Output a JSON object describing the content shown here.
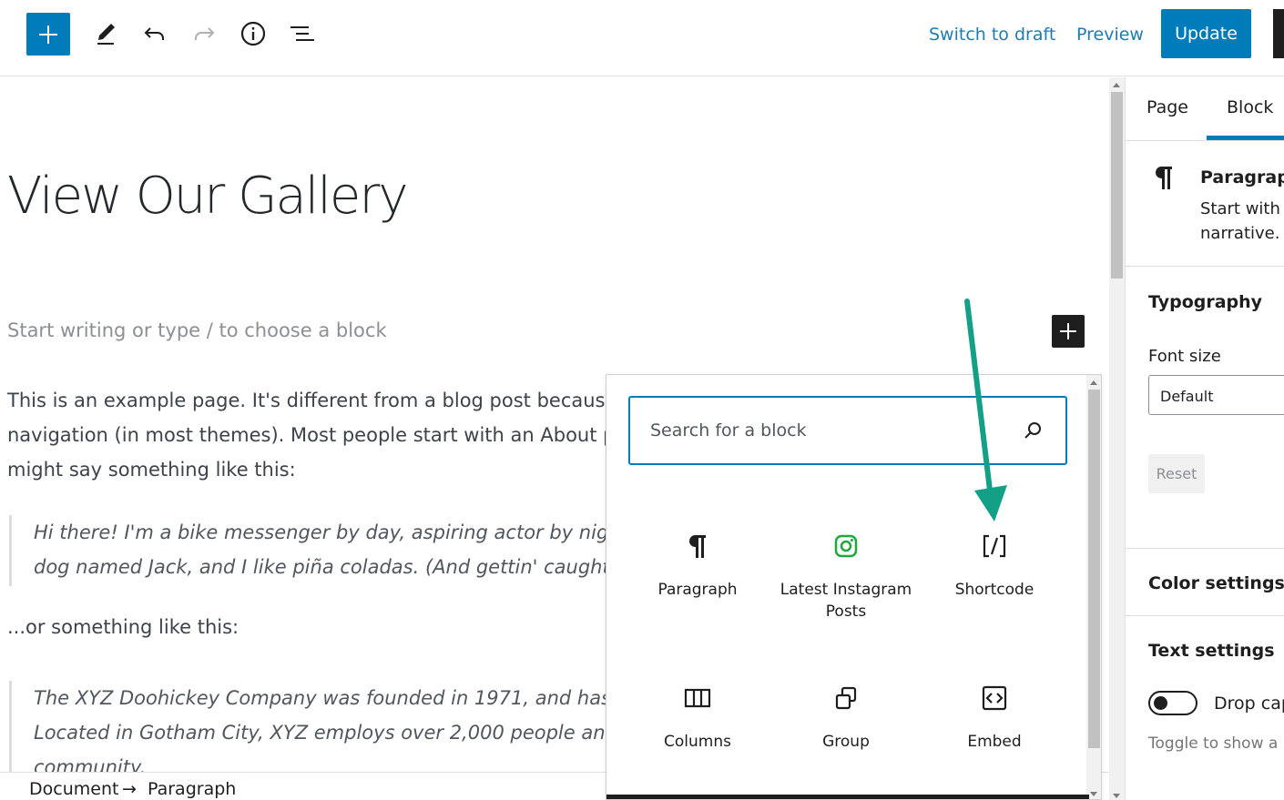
{
  "toolbar": {
    "switch_to_draft": "Switch to draft",
    "preview": "Preview",
    "update": "Update",
    "accent_color": "#007cba"
  },
  "editor": {
    "title": "View Our Gallery",
    "placeholder": "Start writing or type / to choose a block",
    "paragraph_lines": [
      "This is an example page. It's different from a blog post because it w",
      "navigation (in most themes). Most people start with an About page",
      "might say something like this:"
    ],
    "quote1_lines": [
      "Hi there! I'm a bike messenger by day, aspiring actor by night, an",
      "dog named Jack, and I like piña coladas. (And gettin' caught in th"
    ],
    "or_line": "...or something like this:",
    "quote2_lines": [
      "The XYZ Doohickey Company was founded in 1971, and has been",
      "Located in Gotham City, XYZ employs over 2,000 people and does",
      "community."
    ]
  },
  "breadcrumb": {
    "document": "Document",
    "separator": "→",
    "current": "Paragraph"
  },
  "inserter": {
    "search_placeholder": "Search for a block",
    "blocks": [
      {
        "label": "Paragraph",
        "icon": "paragraph-icon"
      },
      {
        "label": "Latest Instagram Posts",
        "icon": "instagram-icon"
      },
      {
        "label": "Shortcode",
        "icon": "shortcode-icon"
      },
      {
        "label": "Columns",
        "icon": "columns-icon"
      },
      {
        "label": "Group",
        "icon": "group-icon"
      },
      {
        "label": "Embed",
        "icon": "embed-icon"
      }
    ],
    "arrow_color": "#14a087"
  },
  "sidebar": {
    "tabs": [
      "Page",
      "Block"
    ],
    "active_tab": "Block",
    "block_card": {
      "name": "Paragraph",
      "description": "Start with t narrative."
    },
    "typography_title": "Typography",
    "font_size_label": "Font size",
    "font_size_value": "Default",
    "reset_label": "Reset",
    "color_settings_title": "Color settings",
    "text_settings_title": "Text settings",
    "drop_cap_label": "Drop cap",
    "drop_cap_help": "Toggle to show a la"
  }
}
